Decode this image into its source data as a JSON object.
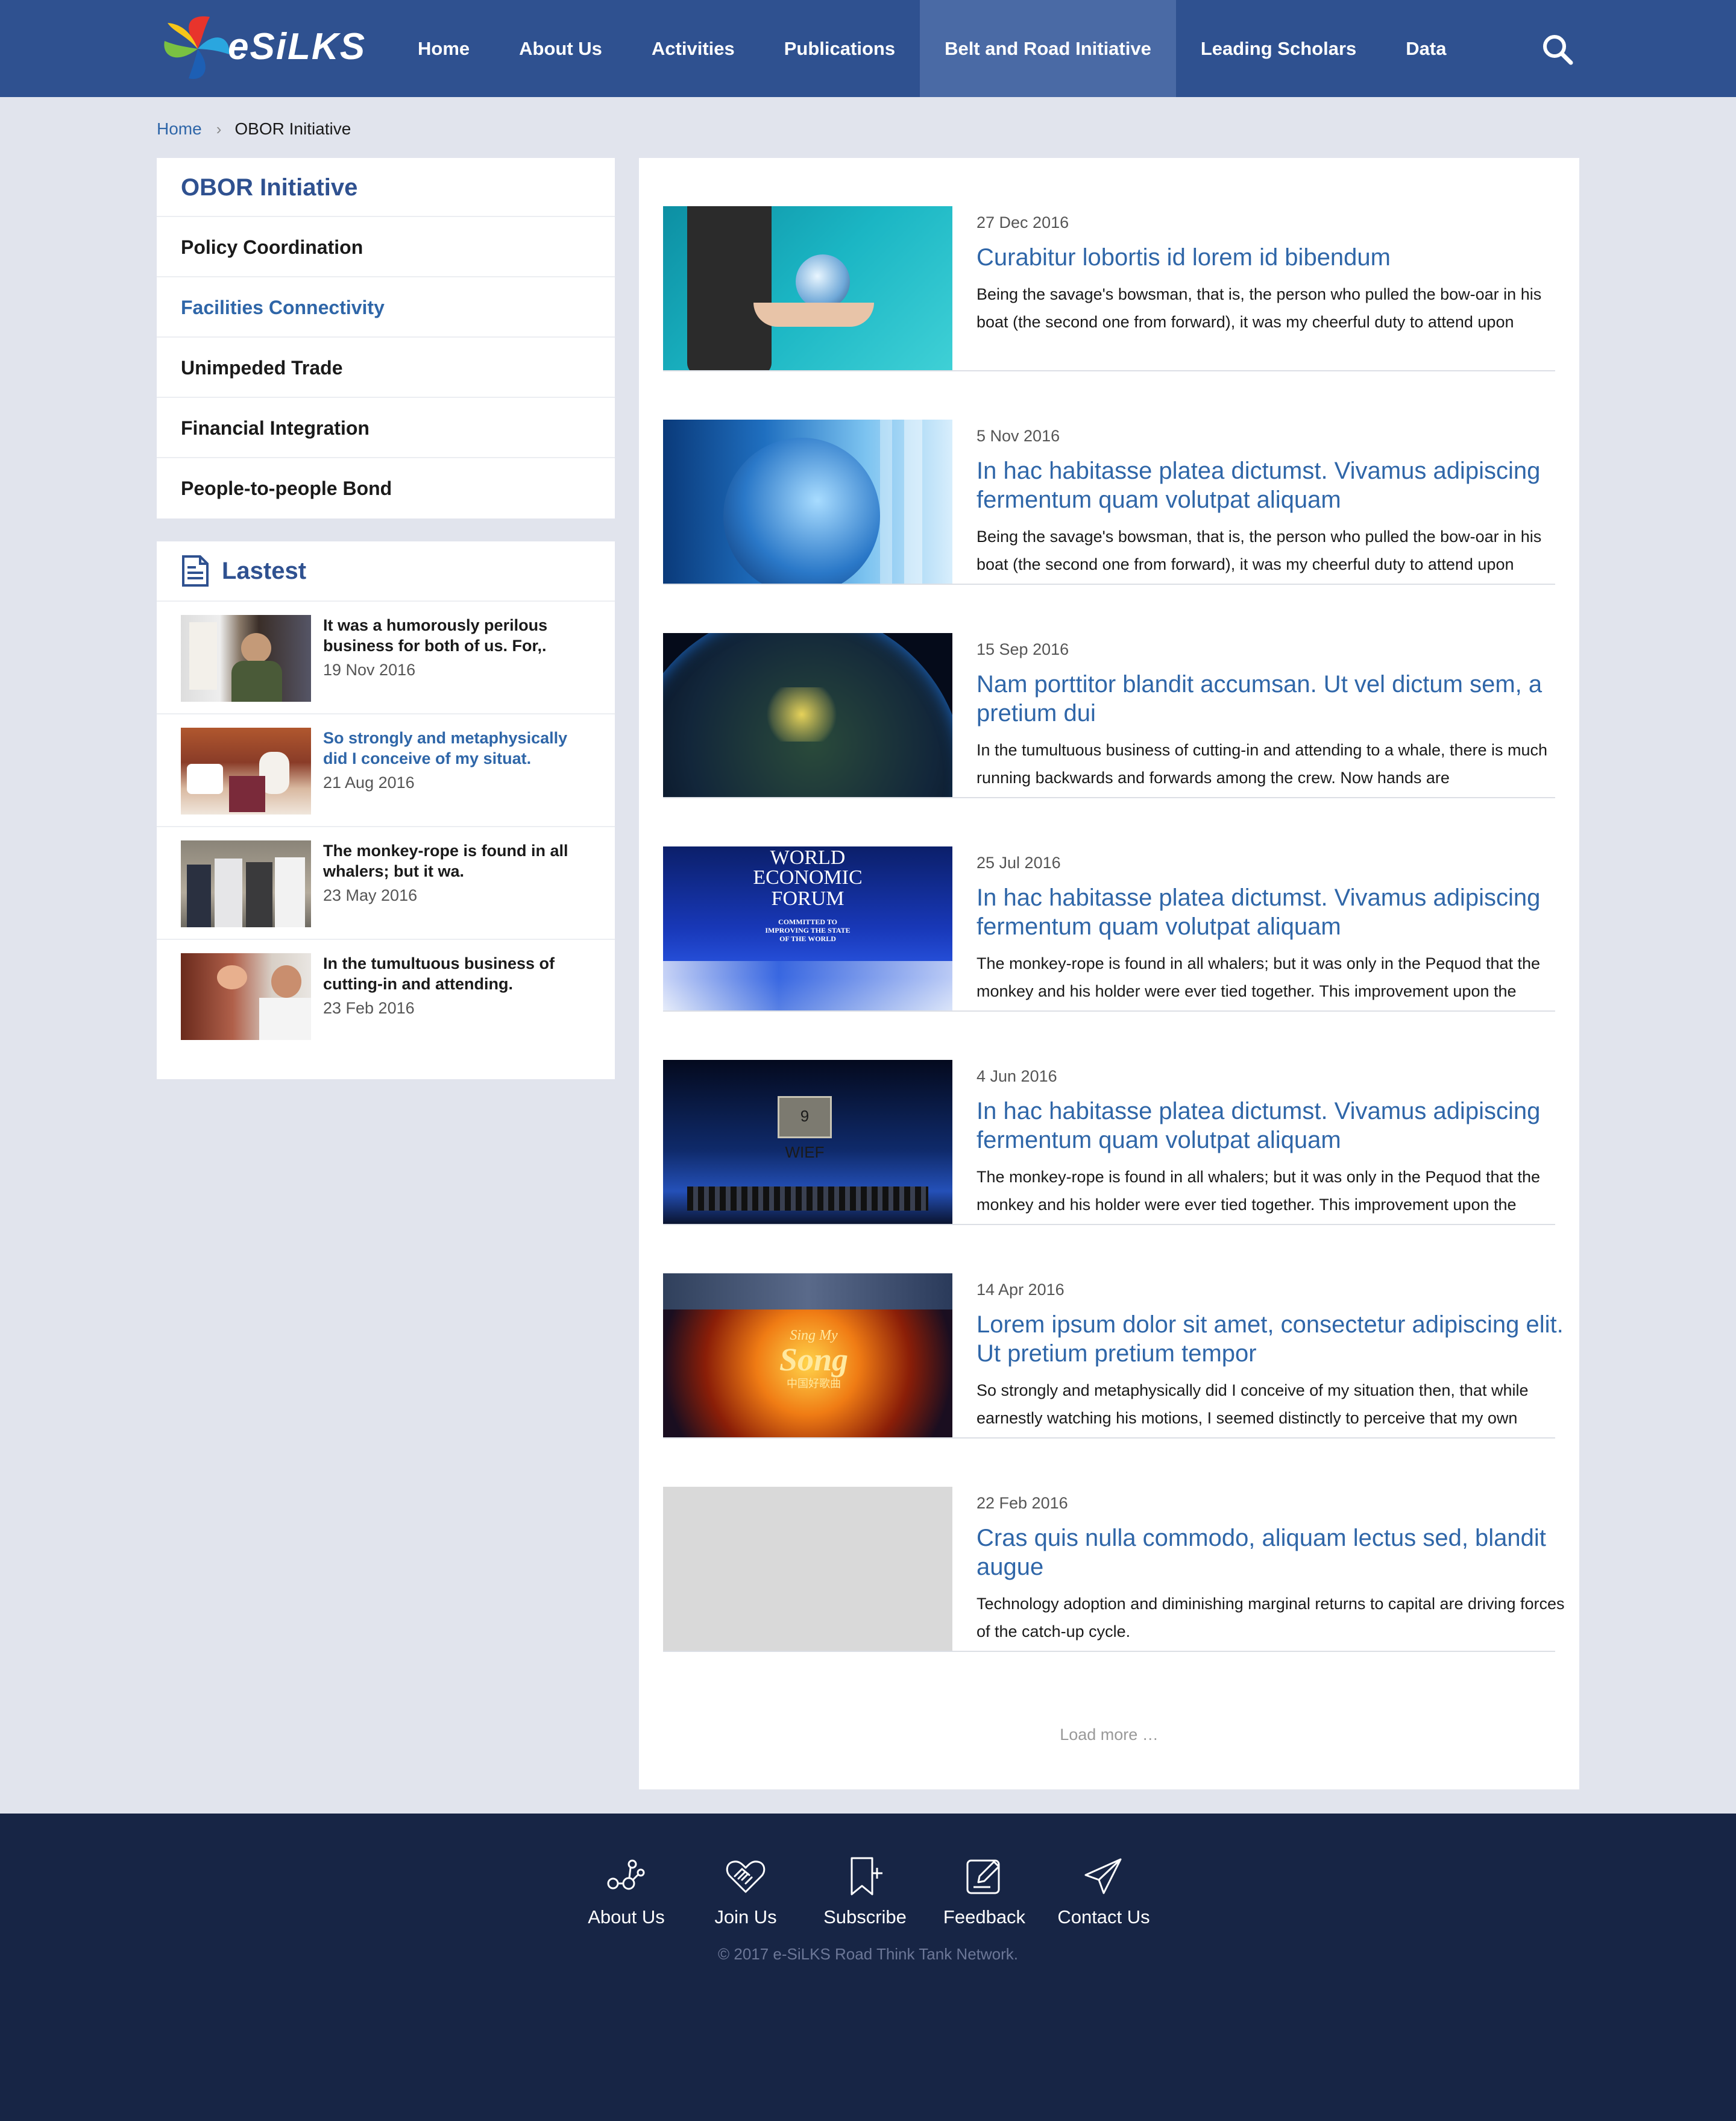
{
  "header": {
    "logo_text": "eSiLKS",
    "nav": [
      "Home",
      "About Us",
      "Activities",
      "Publications",
      "Belt and Road Initiative",
      "Leading Scholars",
      "Data"
    ],
    "active_nav": "Belt and Road Initiative"
  },
  "breadcrumb": {
    "home": "Home",
    "current": "OBOR Initiative"
  },
  "sidebar": {
    "title": "OBOR Initiative",
    "items": [
      {
        "label": "Policy Coordination",
        "active": false
      },
      {
        "label": "Facilities Connectivity",
        "active": true
      },
      {
        "label": "Unimpeded Trade",
        "active": false
      },
      {
        "label": "Financial Integration",
        "active": false
      },
      {
        "label": "People-to-people Bond",
        "active": false
      }
    ]
  },
  "latest": {
    "title": "Lastest",
    "items": [
      {
        "text": "It was a humorously perilous business for both of us. For,.",
        "date": "19 Nov 2016",
        "active": false
      },
      {
        "text": "So strongly and metaphysically did I conceive of my situat.",
        "date": "21 Aug 2016",
        "active": true
      },
      {
        "text": "The monkey-rope is found in all whalers; but it wa.",
        "date": "23 May 2016",
        "active": false
      },
      {
        "text": "In the tumultuous business of cutting-in and attending.",
        "date": "23 Feb 2016",
        "active": false
      }
    ]
  },
  "articles": [
    {
      "date": "27 Dec 2016",
      "title": "Curabitur lobortis id lorem id bibendum",
      "desc": "Being the savage's bowsman, that is, the person who pulled the bow-oar in his boat (the second one from forward), it was my cheerful duty to attend upon",
      "image": "hand-globe"
    },
    {
      "date": "5 Nov 2016",
      "title": "In hac habitasse platea dictumst. Vivamus adipiscing fermentum quam volutpat aliquam",
      "desc": "Being the savage's bowsman, that is, the person who pulled the bow-oar in his boat (the second one from forward), it was my cheerful duty to attend upon",
      "image": "globe-flags"
    },
    {
      "date": "15 Sep 2016",
      "title": "Nam porttitor blandit accumsan. Ut vel dictum sem, a pretium dui",
      "desc": "In the tumultuous business of cutting-in and attending to a whale, there is much running backwards and forwards among the crew. Now hands are",
      "image": "earth-night"
    },
    {
      "date": "25 Jul 2016",
      "title": "In hac habitasse platea dictumst. Vivamus adipiscing fermentum quam volutpat aliquam",
      "desc": "The monkey-rope is found in all whalers; but it was only in the Pequod that the monkey and his holder were ever tied together. This improvement upon the",
      "image": "world-economic-forum",
      "image_text": [
        "WORLD",
        "ECONOMIC",
        "FORUM",
        "COMMITTED TO",
        "IMPROVING THE STATE",
        "OF THE WORLD"
      ]
    },
    {
      "date": "4 Jun 2016",
      "title": "In hac habitasse platea dictumst. Vivamus adipiscing fermentum quam volutpat aliquam",
      "desc": "The monkey-rope is found in all whalers; but it was only in the Pequod that the monkey and his holder were ever tied together. This improvement upon the",
      "image": "wief-stage",
      "image_text": [
        "9 WIEF"
      ]
    },
    {
      "date": "14 Apr 2016",
      "title": "Lorem ipsum dolor sit amet, consectetur adipiscing elit. Ut pretium pretium tempor",
      "desc": "So strongly and metaphysically did I conceive of my situation then, that while earnestly watching his motions, I seemed distinctly to perceive that my own",
      "image": "sing-my-song",
      "image_text": [
        "Sing My",
        "Song",
        "中国好歌曲"
      ]
    },
    {
      "date": "22 Feb 2016",
      "title": "Cras quis nulla commodo, aliquam lectus sed, blandit augue",
      "desc": "Technology adoption and diminishing marginal returns to capital are driving forces of the catch-up cycle.",
      "image": "placeholder"
    }
  ],
  "load_more": "Load more …",
  "footer": {
    "links": [
      {
        "label": "About Us",
        "icon": "network-icon"
      },
      {
        "label": "Join Us",
        "icon": "handshake-heart-icon"
      },
      {
        "label": "Subscribe",
        "icon": "bookmark-plus-icon"
      },
      {
        "label": "Feedback",
        "icon": "edit-icon"
      },
      {
        "label": "Contact Us",
        "icon": "paper-plane-icon"
      }
    ],
    "copyright": "© 2017 e-SiLKS Road Think Tank Network."
  },
  "colors": {
    "header_bg": "#2f5190",
    "nav_active_bg": "#4a6aa5",
    "link_blue": "#2f66a8",
    "page_bg": "#e1e4ed",
    "footer_bg": "#172545"
  }
}
